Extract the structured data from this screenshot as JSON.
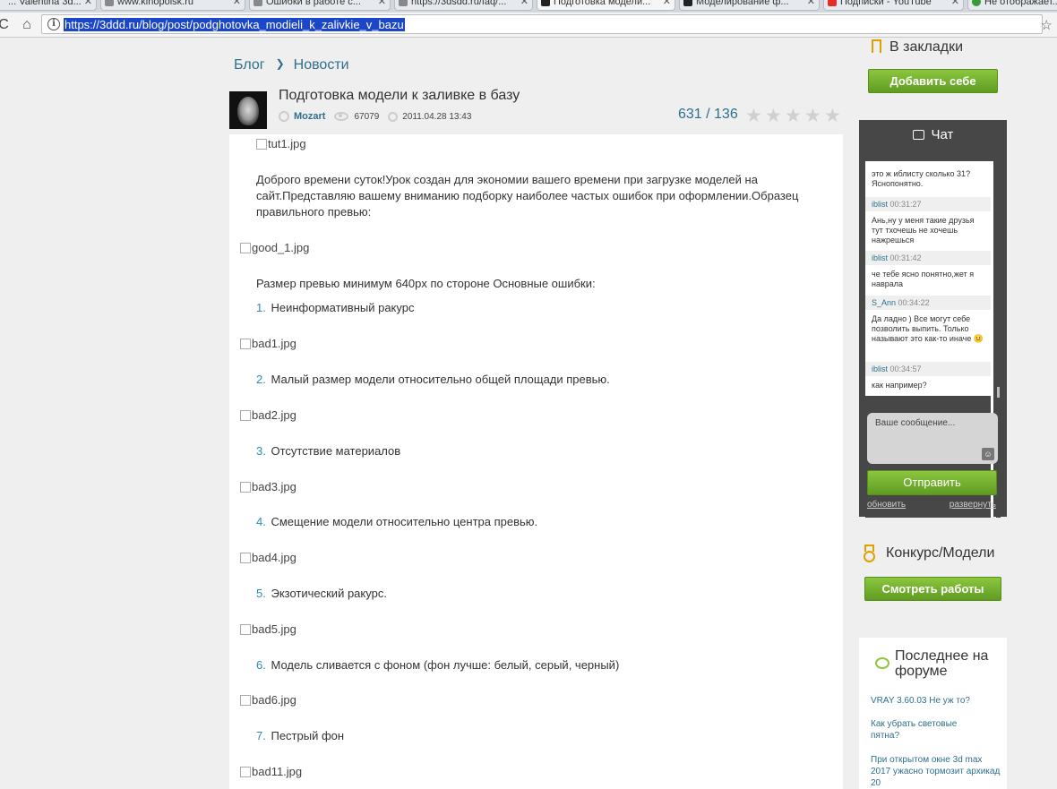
{
  "browser": {
    "tabs": [
      {
        "title": "... Valentina 3d...",
        "active": false
      },
      {
        "title": "www.kinopoisk.ru",
        "active": false
      },
      {
        "title": "Ошибки в работе с...",
        "active": false
      },
      {
        "title": "https://3dsdd.ru/faq/...",
        "active": false
      },
      {
        "title": "Подготовка модели...",
        "active": true
      },
      {
        "title": "Моделирование ф...",
        "active": false
      },
      {
        "title": "Подписки - YouTube",
        "active": false
      },
      {
        "title": "Не отображает...",
        "active": false
      }
    ],
    "url": "https://3ddd.ru/blog/post/podghotovka_modieli_k_zalivkie_v_bazu"
  },
  "breadcrumb": {
    "blog": "Блог",
    "news": "Новости"
  },
  "post": {
    "title": "Подготовка модели к заливке в базу",
    "author": "Mozart",
    "views": "67079",
    "date": "2011.04.28 13:43",
    "rating": "631 / 136",
    "stars": [
      "★",
      "★",
      "★",
      "★",
      "★"
    ]
  },
  "content": {
    "img_tut1": "tut1.jpg",
    "intro": "Доброго времени суток!Урок создан для экономии вашего времени при загрузке моделей на сайт.Представляю вашему вниманию подборку наиболее частых ошибок при оформлении.Образец правильного превью:",
    "img_good": "good_1.jpg",
    "size_note": "Размер превью минимум 640px по стороне Основные ошибки:",
    "items": [
      {
        "num": "1.",
        "text": "Неинформативный ракурс",
        "img": "bad1.jpg"
      },
      {
        "num": "2.",
        "text": "Малый размер модели относительно общей площади превью.",
        "img": "bad2.jpg"
      },
      {
        "num": "3.",
        "text": "Отсутствие материалов",
        "img": "bad3.jpg"
      },
      {
        "num": "4.",
        "text": "Смещение модели относительно центра превью.",
        "img": "bad4.jpg"
      },
      {
        "num": "5.",
        "text": "Экзотический ракурс.",
        "img": "bad5.jpg"
      },
      {
        "num": "6.",
        "text": "Модель сливается с фоном (фон лучше: белый, серый, черный)",
        "img": "bad6.jpg"
      },
      {
        "num": "7.",
        "text": "Пестрый фон",
        "img": "bad11.jpg"
      }
    ]
  },
  "sidebar": {
    "bookmarks_title": "В закладки",
    "add_button": "Добавить себе",
    "chat": {
      "title": "Чат",
      "messages": [
        {
          "text": "это ж иблисту сколько 31? Яснопонятно.",
          "nick": "iblist",
          "time": "00:31:27"
        },
        {
          "text": "Ань,ну у меня такие друзья тут тхочешь не хочешь нажрешься",
          "nick": "iblist",
          "time": "00:31:42"
        },
        {
          "text": "че тебе ясно понятно,жет я наврала",
          "nick": "S_Ann",
          "time": "00:34:22"
        },
        {
          "text": "Да ладно ) Все могут себе позволить выпить. Только называют это как-то иначе 😐",
          "nick": "iblist",
          "time": "00:34:57"
        },
        {
          "text": "как например?",
          "nick": "",
          "time": ""
        }
      ],
      "input_placeholder": "Ваше сообщение...",
      "send_button": "Отправить",
      "refresh_link": "обновить",
      "expand_link": "развернуть"
    },
    "contest_title": "Конкурс/Модели",
    "contest_button": "Смотреть работы",
    "forum": {
      "title": "Последнее на форуме",
      "links": [
        "VRAY 3.60.03 Не уж то?",
        "Как убрать световые пятна?",
        "При открытом окне 3d max 2017 ужасно тормозит архикад 20"
      ]
    }
  }
}
